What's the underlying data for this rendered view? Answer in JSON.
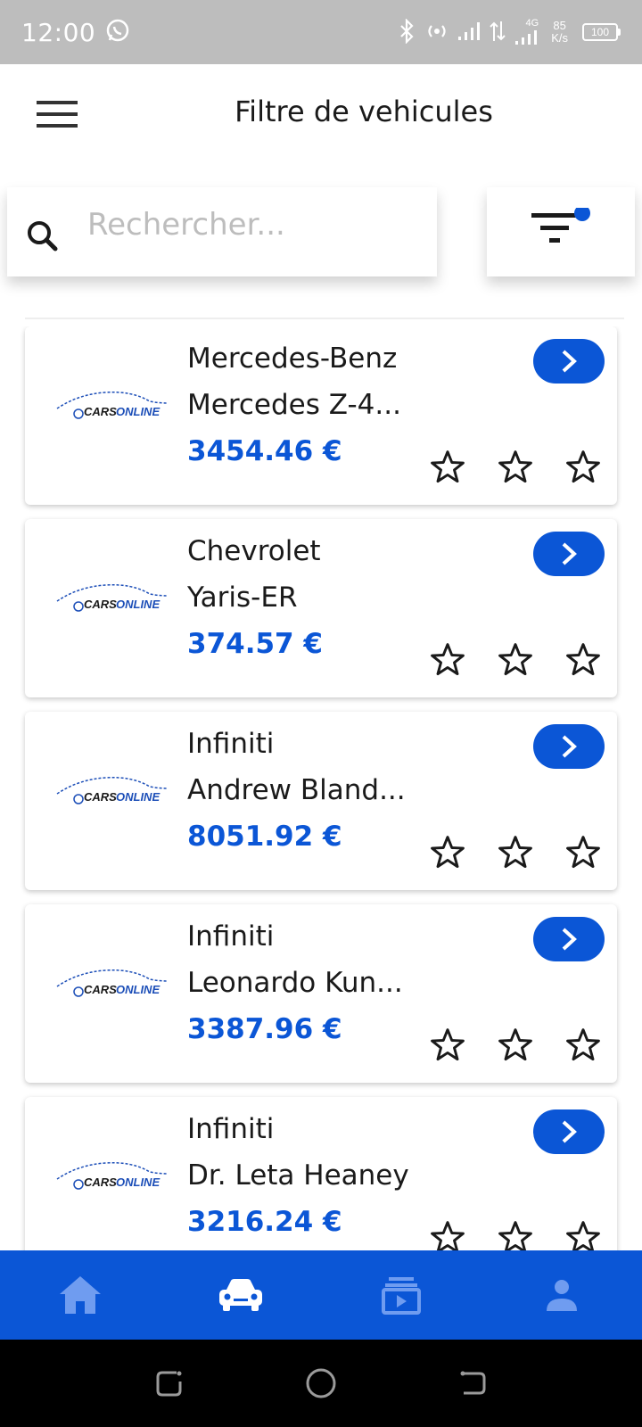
{
  "status_bar": {
    "time": "12:00",
    "net_speed_value": "85",
    "net_speed_unit": "K/s",
    "network_type": "4G",
    "battery": "100",
    "icons": [
      "whatsapp-icon",
      "bluetooth-icon",
      "hotspot-icon",
      "signal-icon",
      "data-arrows-icon",
      "signal-4g-icon"
    ]
  },
  "header": {
    "title": "Filtre de vehicules",
    "menu_icon": "hamburger-menu-icon"
  },
  "search": {
    "placeholder": "Rechercher...",
    "value": "",
    "icon": "search-icon"
  },
  "filter": {
    "icon": "filter-icon",
    "active_indicator": true
  },
  "colors": {
    "accent": "#0b56d6",
    "status_bar": "#bdbdbd",
    "text": "#1a1a1a",
    "placeholder": "#bdbdbd"
  },
  "vehicles": [
    {
      "make": "Mercedes-Benz",
      "model": "Mercedes Z-4...",
      "price": "3454.46 €",
      "logo": "CARS ONLINE",
      "rating": 0
    },
    {
      "make": "Chevrolet",
      "model": "Yaris-ER",
      "price": "374.57 €",
      "logo": "CARS ONLINE",
      "rating": 0
    },
    {
      "make": "Infiniti",
      "model": "Andrew Bland...",
      "price": "8051.92 €",
      "logo": "CARS ONLINE",
      "rating": 0
    },
    {
      "make": "Infiniti",
      "model": "Leonardo Kun...",
      "price": "3387.96 €",
      "logo": "CARS ONLINE",
      "rating": 0
    },
    {
      "make": "Infiniti",
      "model": "Dr. Leta Heaney",
      "price": "3216.24 €",
      "logo": "CARS ONLINE",
      "rating": 0
    }
  ],
  "bottom_nav": {
    "items": [
      {
        "icon": "home-icon",
        "active": false
      },
      {
        "icon": "car-icon",
        "active": true
      },
      {
        "icon": "video-library-icon",
        "active": false
      },
      {
        "icon": "person-icon",
        "active": false
      }
    ]
  },
  "system_nav": {
    "items": [
      "recent-apps-icon",
      "home-circle-icon",
      "back-icon"
    ]
  }
}
